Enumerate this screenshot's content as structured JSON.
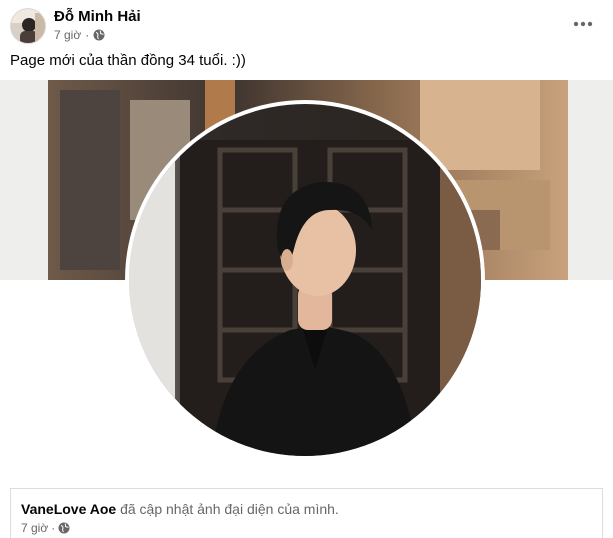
{
  "post": {
    "author": "Đỗ Minh Hải",
    "time": "7 giờ",
    "separator": "·",
    "text": "Page mới của thần đồng 34 tuổi. :))",
    "privacy_icon": "globe-icon",
    "menu_icon": "more-options-icon"
  },
  "shared": {
    "page_name": "VaneLove Aoe",
    "action": " đã cập nhật ảnh đại diện của mình.",
    "time": "7 giờ",
    "separator": "·",
    "privacy_icon": "globe-icon"
  },
  "colors": {
    "text_primary": "#050505",
    "text_secondary": "#65676b",
    "border": "#dadde1"
  }
}
